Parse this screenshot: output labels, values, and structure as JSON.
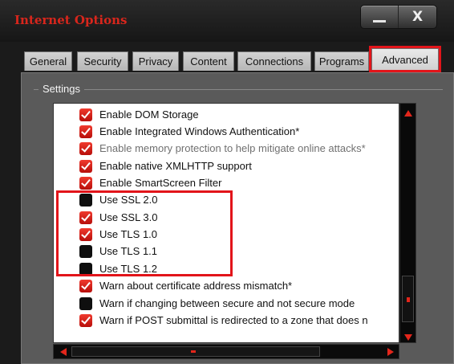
{
  "window": {
    "title": "Internet Options",
    "close_glyph": "X",
    "accent": "#d8261c"
  },
  "tabs": [
    {
      "label": "General"
    },
    {
      "label": "Security"
    },
    {
      "label": "Privacy"
    },
    {
      "label": "Content"
    },
    {
      "label": "Connections"
    },
    {
      "label": "Programs"
    },
    {
      "label": "Advanced",
      "active": true
    }
  ],
  "settings": {
    "label": "Settings",
    "items": [
      {
        "label": "Enable DOM Storage",
        "checked": true
      },
      {
        "label": "Enable Integrated Windows Authentication*",
        "checked": true
      },
      {
        "label": "Enable memory protection to help mitigate online attacks*",
        "checked": true,
        "disabled": true
      },
      {
        "label": "Enable native XMLHTTP support",
        "checked": true
      },
      {
        "label": "Enable SmartScreen Filter",
        "checked": true
      },
      {
        "label": "Use SSL 2.0",
        "checked": false
      },
      {
        "label": "Use SSL 3.0",
        "checked": true
      },
      {
        "label": "Use TLS 1.0",
        "checked": true
      },
      {
        "label": "Use TLS 1.1",
        "checked": false
      },
      {
        "label": "Use TLS 1.2",
        "checked": false
      },
      {
        "label": "Warn about certificate address mismatch*",
        "checked": true
      },
      {
        "label": "Warn if changing between secure and not secure mode",
        "checked": false
      },
      {
        "label": "Warn if POST submittal is redirected to a zone that does n",
        "checked": true
      }
    ]
  },
  "colors": {
    "highlight": "#e2141a",
    "checkbox_checked": "#d8261c",
    "checkbox_unchecked": "#0f0f0f"
  }
}
